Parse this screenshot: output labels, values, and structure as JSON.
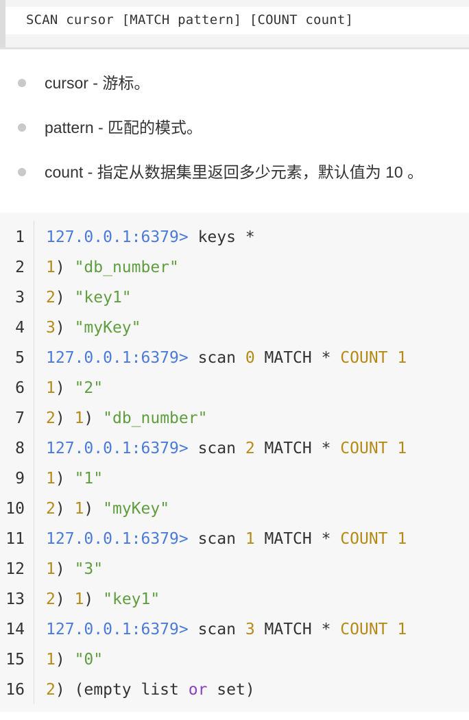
{
  "syntax": {
    "text": "SCAN cursor [MATCH pattern] [COUNT count]"
  },
  "params": [
    {
      "text": "cursor - 游标。"
    },
    {
      "text": "pattern - 匹配的模式。"
    },
    {
      "text": "count - 指定从数据集里返回多少元素，默认值为 10 。"
    }
  ],
  "code": {
    "lines": [
      {
        "n": "1",
        "tokens": [
          {
            "t": "prompt",
            "v": "127.0.0.1:6379>"
          },
          {
            "t": "plain",
            "v": " keys *"
          }
        ]
      },
      {
        "n": "2",
        "tokens": [
          {
            "t": "num",
            "v": "1"
          },
          {
            "t": "plain",
            "v": ") "
          },
          {
            "t": "str",
            "v": "\"db_number\""
          }
        ]
      },
      {
        "n": "3",
        "tokens": [
          {
            "t": "num",
            "v": "2"
          },
          {
            "t": "plain",
            "v": ") "
          },
          {
            "t": "str",
            "v": "\"key1\""
          }
        ]
      },
      {
        "n": "4",
        "tokens": [
          {
            "t": "num",
            "v": "3"
          },
          {
            "t": "plain",
            "v": ") "
          },
          {
            "t": "str",
            "v": "\"myKey\""
          }
        ]
      },
      {
        "n": "5",
        "tokens": [
          {
            "t": "prompt",
            "v": "127.0.0.1:6379>"
          },
          {
            "t": "plain",
            "v": " scan "
          },
          {
            "t": "num",
            "v": "0"
          },
          {
            "t": "plain",
            "v": " MATCH * "
          },
          {
            "t": "num",
            "v": "COUNT 1"
          }
        ]
      },
      {
        "n": "6",
        "tokens": [
          {
            "t": "num",
            "v": "1"
          },
          {
            "t": "plain",
            "v": ") "
          },
          {
            "t": "str",
            "v": "\"2\""
          }
        ]
      },
      {
        "n": "7",
        "tokens": [
          {
            "t": "num",
            "v": "2"
          },
          {
            "t": "plain",
            "v": ") "
          },
          {
            "t": "num",
            "v": "1"
          },
          {
            "t": "plain",
            "v": ") "
          },
          {
            "t": "str",
            "v": "\"db_number\""
          }
        ]
      },
      {
        "n": "8",
        "tokens": [
          {
            "t": "prompt",
            "v": "127.0.0.1:6379>"
          },
          {
            "t": "plain",
            "v": " scan "
          },
          {
            "t": "num",
            "v": "2"
          },
          {
            "t": "plain",
            "v": " MATCH * "
          },
          {
            "t": "num",
            "v": "COUNT 1"
          }
        ]
      },
      {
        "n": "9",
        "tokens": [
          {
            "t": "num",
            "v": "1"
          },
          {
            "t": "plain",
            "v": ") "
          },
          {
            "t": "str",
            "v": "\"1\""
          }
        ]
      },
      {
        "n": "10",
        "tokens": [
          {
            "t": "num",
            "v": "2"
          },
          {
            "t": "plain",
            "v": ") "
          },
          {
            "t": "num",
            "v": "1"
          },
          {
            "t": "plain",
            "v": ") "
          },
          {
            "t": "str",
            "v": "\"myKey\""
          }
        ]
      },
      {
        "n": "11",
        "tokens": [
          {
            "t": "prompt",
            "v": "127.0.0.1:6379>"
          },
          {
            "t": "plain",
            "v": " scan "
          },
          {
            "t": "num",
            "v": "1"
          },
          {
            "t": "plain",
            "v": " MATCH * "
          },
          {
            "t": "num",
            "v": "COUNT 1"
          }
        ]
      },
      {
        "n": "12",
        "tokens": [
          {
            "t": "num",
            "v": "1"
          },
          {
            "t": "plain",
            "v": ") "
          },
          {
            "t": "str",
            "v": "\"3\""
          }
        ]
      },
      {
        "n": "13",
        "tokens": [
          {
            "t": "num",
            "v": "2"
          },
          {
            "t": "plain",
            "v": ") "
          },
          {
            "t": "num",
            "v": "1"
          },
          {
            "t": "plain",
            "v": ") "
          },
          {
            "t": "str",
            "v": "\"key1\""
          }
        ]
      },
      {
        "n": "14",
        "tokens": [
          {
            "t": "prompt",
            "v": "127.0.0.1:6379>"
          },
          {
            "t": "plain",
            "v": " scan "
          },
          {
            "t": "num",
            "v": "3"
          },
          {
            "t": "plain",
            "v": " MATCH * "
          },
          {
            "t": "num",
            "v": "COUNT 1"
          }
        ]
      },
      {
        "n": "15",
        "tokens": [
          {
            "t": "num",
            "v": "1"
          },
          {
            "t": "plain",
            "v": ") "
          },
          {
            "t": "str",
            "v": "\"0\""
          }
        ]
      },
      {
        "n": "16",
        "tokens": [
          {
            "t": "num",
            "v": "2"
          },
          {
            "t": "plain",
            "v": ") (empty list "
          },
          {
            "t": "kw",
            "v": "or"
          },
          {
            "t": "plain",
            "v": " set)"
          }
        ]
      }
    ]
  }
}
